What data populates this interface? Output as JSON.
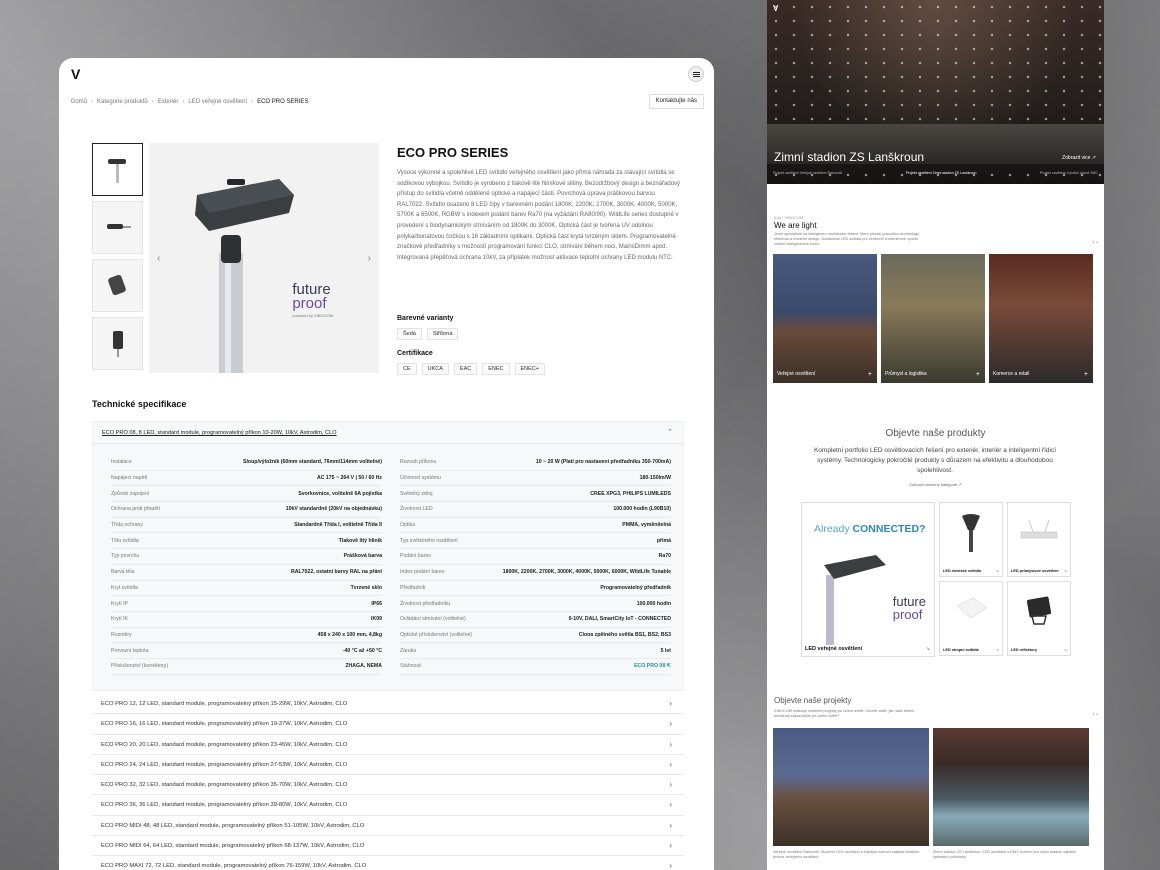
{
  "left": {
    "logo": "V",
    "breadcrumb": [
      "Domů",
      "Kategorie produktů",
      "Exteriér",
      "LED veřejné osvětlení",
      "ECO PRO SERIES"
    ],
    "contact_label": "Kontaktujte nás",
    "product": {
      "title": "ECO PRO SERIES",
      "description": "Vysoce výkonné a spolehlivé LED svítidlo veřejného osvětlení jako přímá náhrada za stávající svítidla se sodíkovou výbojkou. Svítidlo je vyrobeno z tlakově lité hliníkové slitiny. Bezúdržbový design a beznářadový přístup do svítidla včetně oddělené optické a napájecí části. Povrchová úprava práškovou barvou RAL7022. Svítidlo osazeno 8 LED čipy v barevném podání 1800K, 2200K, 2700K, 3000K, 4000K, 5000K, 5700K a 6500K, RGBW s indexem podání barev Ra70 (na vyžádání RA80/90). WildLife series dostupné v provedení s biodynamickým stmíváním od 1800K do 3000K. Optická část je tvořena UV odolnou polykarbonátovou čočkou s 16 základními optikami. Optická část krytá tvrzeným sklem. Programovatelné značkové předřadníky s možností programování funkcí CLO, stmívání během noci, MainsDimm apod. Integrovaná přepěťová ochrana 10kV, za příplatek možnost aktivace teplotní ochrany LED modulu NTC.",
      "future_line1": "future",
      "future_line2": "proof",
      "future_line3": "powered by VIBOCOM",
      "variants_title": "Barevné varianty",
      "variants": [
        "Šedá",
        "Stříbrná"
      ],
      "cert_title": "Certifikace",
      "certs": [
        "CE",
        "UKCA",
        "EAC",
        "ENEC",
        "ENEC+"
      ]
    },
    "tech_title": "Technické specifikace",
    "spec_header": "ECO PRO 08, 8 LED, standard module, programovatelný příkon 10-20W, 10kV, Astrodim, CLO",
    "spec_left": [
      [
        "Instalace",
        "Sloup/výložník (60mm standard, 76mm/114mm volitelné)"
      ],
      [
        "Napájecí napětí",
        "AC 175 ~ 264 V | 50 / 60 Hz"
      ],
      [
        "Způsob zapojení",
        "Svorkovnice, volitelně 6A pojistka"
      ],
      [
        "Ochrana proti přepětí",
        "10kV standardně (20kV na objednávku)"
      ],
      [
        "Třída ochrany",
        "Standardně Třída I, volitelně Třída II"
      ],
      [
        "Tělo svítidla",
        "Tlakově litý hliník"
      ],
      [
        "Typ povrchu",
        "Prášková barva"
      ],
      [
        "Barva těla",
        "RAL7022, ostatní barvy RAL na přání"
      ],
      [
        "Kryt svítidla",
        "Tvrzené sklo"
      ],
      [
        "Krytí IP",
        "IP66"
      ],
      [
        "Krytí IK",
        "IK09"
      ],
      [
        "Rozměry",
        "458 x 240 x 100 mm, 4,8kg"
      ],
      [
        "Provozní teplota",
        "-40 °C až +50 °C"
      ],
      [
        "Příslušenství (konektory)",
        "ZHAGA, NEMA"
      ]
    ],
    "spec_right": [
      [
        "Rozsah příkonu",
        "10 ~ 20 W (Platí pro nastavení předřadníku 350-700mA)"
      ],
      [
        "Účinnost systému",
        "180-150lm/W"
      ],
      [
        "Světelný zdroj",
        "CREE XPG3, PHILIPS LUMILEDS"
      ],
      [
        "Životnost LED",
        "100.000 hodin (L90B10)"
      ],
      [
        "Optika",
        "PMMA, vyměnitelná"
      ],
      [
        "Typ světelného rozdělení",
        "přímá"
      ],
      [
        "Podání barev",
        "Ra70"
      ],
      [
        "Index podání barev",
        "1800K, 2200K, 2700K, 3000K, 4000K, 5000K, 6000K, WildLife Tunable"
      ],
      [
        "Předřadník",
        "Programovatelný předřadník"
      ],
      [
        "Životnost předřadníku",
        "100.000 hodin"
      ],
      [
        "Ovládání stmívání (volitelné)",
        "0-10V, DALI, SmartCity IoT - CONNECTED"
      ],
      [
        "Optické příslušenství (volitelné)",
        "Clona zpětného světla BS1, BS2, BS3"
      ],
      [
        "Záruka",
        "5 let"
      ],
      [
        "Stáhnout",
        "ECO PRO 08 ⇱"
      ]
    ],
    "variant_rows": [
      "ECO PRO 12, 12 LED, standard module, programovatelný příkon 15-29W, 10kV, Astrodim, CLO",
      "ECO PRO 16, 16 LED, standard module, programovatelný příkon 19-37W, 10kV, Astrodim, CLO",
      "ECO PRO 20, 20 LED, standard module, programovatelný příkon 23-45W, 10kV, Astrodim, CLO",
      "ECO PRO 24, 24 LED, standard module, programovatelný příkon 27-53W, 10kV, Astrodim, CLO",
      "ECO PRO 32, 32 LED, standard module, programovatelný příkon 35-70W, 10kV, Astrodim, CLO",
      "ECO PRO 36, 36 LED, standard module, programovatelný příkon 39-80W, 10kV, Astrodim, CLO",
      "ECO PRO MIDI 48, 48 LED, standard module, programovatelný příkon 51-105W, 10kV, Astrodim, CLO",
      "ECO PRO MIDI 64, 64 LED, standard module, programovatelný příkon 68-137W, 10kV, Astrodim, CLO",
      "ECO PRO MAXI 72, 72 LED, standard module, programovatelný příkon 76-159W, 10kV, Astrodim, CLO"
    ]
  },
  "right": {
    "hero_logo": "V",
    "hero_title": "Zimní stadion ZS Lanškroun",
    "hero_more": "Zobrazit vice ↗",
    "hero_tabs": [
      "Projekt osvětlení Veřejné osvětlení Rakovník",
      "Projekt osvětlení Zimní stadion ZS Lanškroun",
      "Projekt osvětlení Výrobní závod SMC"
    ],
    "about_small": "Kdo? VIBOCOM",
    "about_title": "We are light",
    "about_text": "Jsme specialisté na inteligentní osvětlovací řešení, které přináší pokročilou technologii, efektivitu a moderní design. Dodáváme LED svítidla pro venkovní a interiérové využití včetně inteligentního řízení.",
    "cards": [
      {
        "label": "Veřejné osvětlení"
      },
      {
        "label": "Průmysl a logistika"
      },
      {
        "label": "Komerce a retail"
      }
    ],
    "products_title": "Objevte naše produkty",
    "products_text": "Kompletní portfolio LED osvětlovacích řešení pro exteriér, interiér a inteligentní řídicí systémy. Technologicky pokročilé produkty s důrazem na efektivitu a dlouhodobou spolehlivost.",
    "products_link": "Zobrazit všechny kategorie ↗",
    "big_product": {
      "already": "Already",
      "connected": "CONNECTED?",
      "fp1": "future",
      "fp2": "proof",
      "label": "LED veřejné osvětlení"
    },
    "small_products": [
      "LED městské svítidlo",
      "LED průmyslové osvětlení",
      "LED stropní svítidla",
      "LED reflektory"
    ],
    "projects_title": "Objevte naše projekty",
    "projects_text": "VIBOCOM realizuje světelné projekty po celém světě. Chcete vidět, jak naše řešení pomáhají zákazníkům po celém světě?",
    "project_captions": [
      "Veřejné osvětlení Rakovník. Moderní LED osvětlení s chytrým řízením zajistilo efektivní provoz veřejného osvětlení.",
      "Zimní stadion ZS Lanškroun. LED osvětlení s DMX řízením pro zimní stadion zajistilo optimální podmínky."
    ]
  }
}
